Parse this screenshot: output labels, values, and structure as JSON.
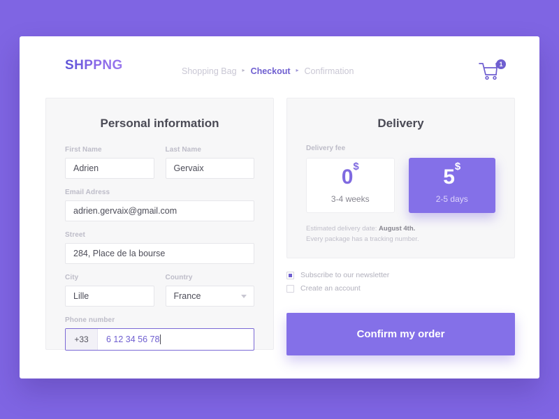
{
  "brand": {
    "logo": "SHPPNG",
    "accent": "#6f5fd0",
    "button": "#8470e8",
    "background": "#7f65e3"
  },
  "header": {
    "breadcrumb": [
      {
        "label": "Shopping Bag",
        "active": false
      },
      {
        "label": "Checkout",
        "active": true
      },
      {
        "label": "Confirmation",
        "active": false
      }
    ],
    "separator": "▸",
    "cart": {
      "icon": "shopping-cart-icon",
      "badge": "1"
    }
  },
  "personal": {
    "title": "Personal information",
    "first_name": {
      "label": "First Name",
      "value": "Adrien"
    },
    "last_name": {
      "label": "Last Name",
      "value": "Gervaix"
    },
    "email": {
      "label": "Email Adress",
      "value": "adrien.gervaix@gmail.com"
    },
    "street": {
      "label": "Street",
      "value": "284, Place de la bourse"
    },
    "city": {
      "label": "City",
      "value": "Lille"
    },
    "country": {
      "label": "Country",
      "value": "France"
    },
    "phone": {
      "label": "Phone number",
      "prefix": "+33",
      "value": "6 12 34 56 78"
    }
  },
  "delivery": {
    "title": "Delivery",
    "fee_label": "Delivery fee",
    "options": [
      {
        "price": "0",
        "currency": "$",
        "time": "3-4 weeks",
        "selected": false
      },
      {
        "price": "5",
        "currency": "$",
        "time": "2-5 days",
        "selected": true
      }
    ],
    "estimate_prefix": "Estimated delivery date: ",
    "estimate_date": "August 4th.",
    "tracking_note": "Every package has a tracking number."
  },
  "options": {
    "newsletter": {
      "label": "Subscribe to our newsletter",
      "checked": true
    },
    "create_account": {
      "label": "Create an account",
      "checked": false
    }
  },
  "confirm_button": "Confirm my order"
}
